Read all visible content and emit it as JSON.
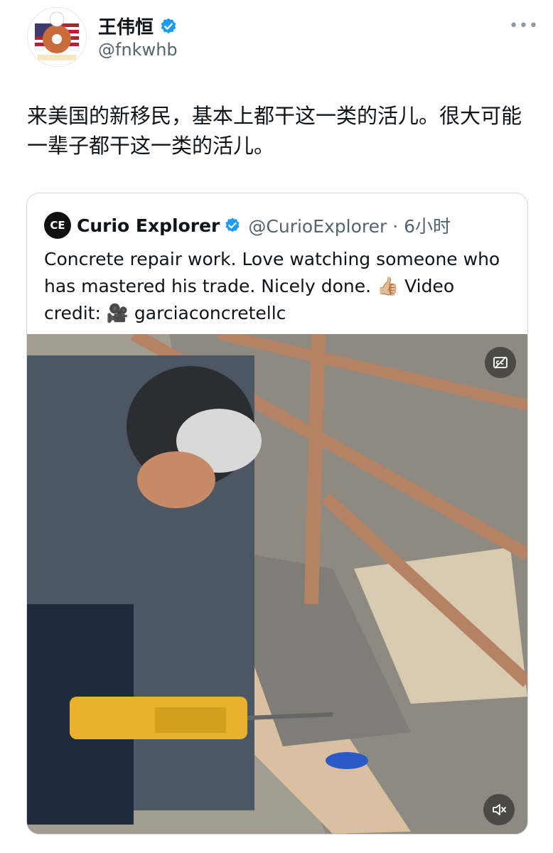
{
  "author": {
    "display_name": "王伟恒",
    "handle": "@fnkwhb",
    "verified": true
  },
  "post": {
    "text": "来美国的新移民，基本上都干这一类的活儿。很大可能一辈子都干这一类的活儿。"
  },
  "quoted_post": {
    "logo_text": "CE",
    "display_name": "Curio Explorer",
    "handle_time": "@CurioExplorer · 6小时",
    "text": "Concrete repair work. Love watching someone who has mastered his trade. Nicely done. 👍🏼 Video credit: 🎥 garciaconcretellc"
  },
  "colors": {
    "verified_blue": "#1d9bf0",
    "text_primary": "#0f1419",
    "text_secondary": "#536471",
    "border": "#cfd9de"
  }
}
